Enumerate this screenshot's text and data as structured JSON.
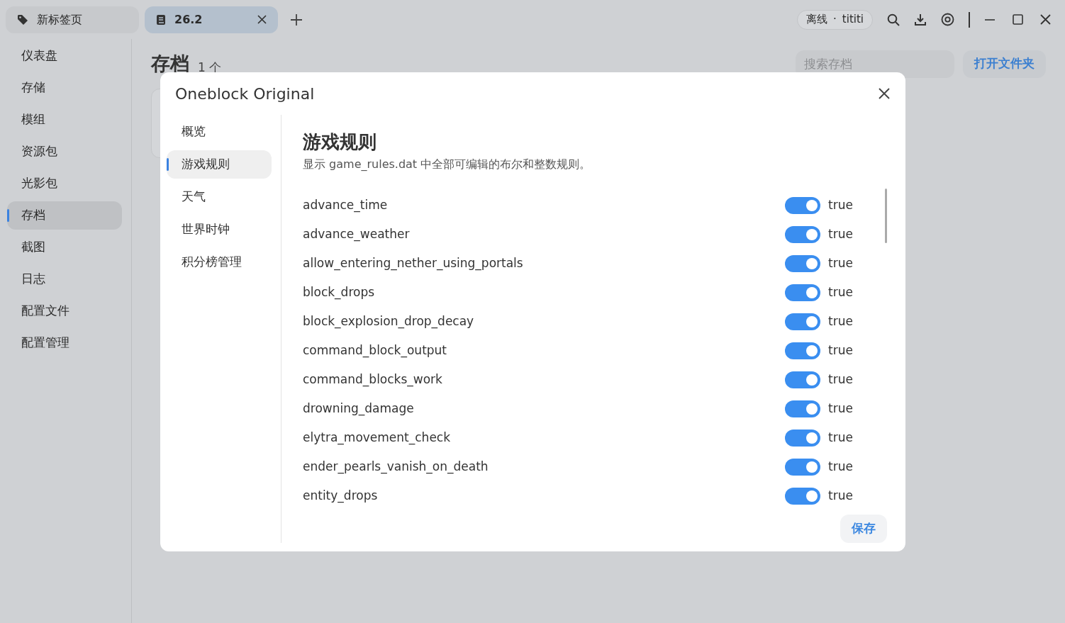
{
  "tabs": [
    {
      "label": "新标签页",
      "selected": false,
      "closable": false
    },
    {
      "label": "26.2",
      "selected": true,
      "closable": true
    }
  ],
  "account": {
    "status": "离线",
    "separator": "·",
    "user": "tititi"
  },
  "sidebar": {
    "items": [
      {
        "label": "仪表盘",
        "selected": false
      },
      {
        "label": "存储",
        "selected": false
      },
      {
        "label": "模组",
        "selected": false
      },
      {
        "label": "资源包",
        "selected": false
      },
      {
        "label": "光影包",
        "selected": false
      },
      {
        "label": "存档",
        "selected": true
      },
      {
        "label": "截图",
        "selected": false
      },
      {
        "label": "日志",
        "selected": false
      },
      {
        "label": "配置文件",
        "selected": false
      },
      {
        "label": "配置管理",
        "selected": false
      }
    ]
  },
  "page": {
    "title": "存档",
    "count": "1 个",
    "search": {
      "placeholder": "搜索存档"
    },
    "open_folder": "打开文件夹"
  },
  "dialog": {
    "title": "Oneblock Original",
    "nav": [
      {
        "label": "概览",
        "selected": false
      },
      {
        "label": "游戏规则",
        "selected": true
      },
      {
        "label": "天气",
        "selected": false
      },
      {
        "label": "世界时钟",
        "selected": false
      },
      {
        "label": "积分榜管理",
        "selected": false
      }
    ],
    "heading": "游戏规则",
    "description": "显示 game_rules.dat 中全部可编辑的布尔和整数规则。",
    "rules": [
      {
        "name": "advance_time",
        "on": true,
        "value": "true"
      },
      {
        "name": "advance_weather",
        "on": true,
        "value": "true"
      },
      {
        "name": "allow_entering_nether_using_portals",
        "on": true,
        "value": "true"
      },
      {
        "name": "block_drops",
        "on": true,
        "value": "true"
      },
      {
        "name": "block_explosion_drop_decay",
        "on": true,
        "value": "true"
      },
      {
        "name": "command_block_output",
        "on": true,
        "value": "true"
      },
      {
        "name": "command_blocks_work",
        "on": true,
        "value": "true"
      },
      {
        "name": "drowning_damage",
        "on": true,
        "value": "true"
      },
      {
        "name": "elytra_movement_check",
        "on": true,
        "value": "true"
      },
      {
        "name": "ender_pearls_vanish_on_death",
        "on": true,
        "value": "true"
      },
      {
        "name": "entity_drops",
        "on": true,
        "value": "true"
      }
    ],
    "save": "保存"
  }
}
